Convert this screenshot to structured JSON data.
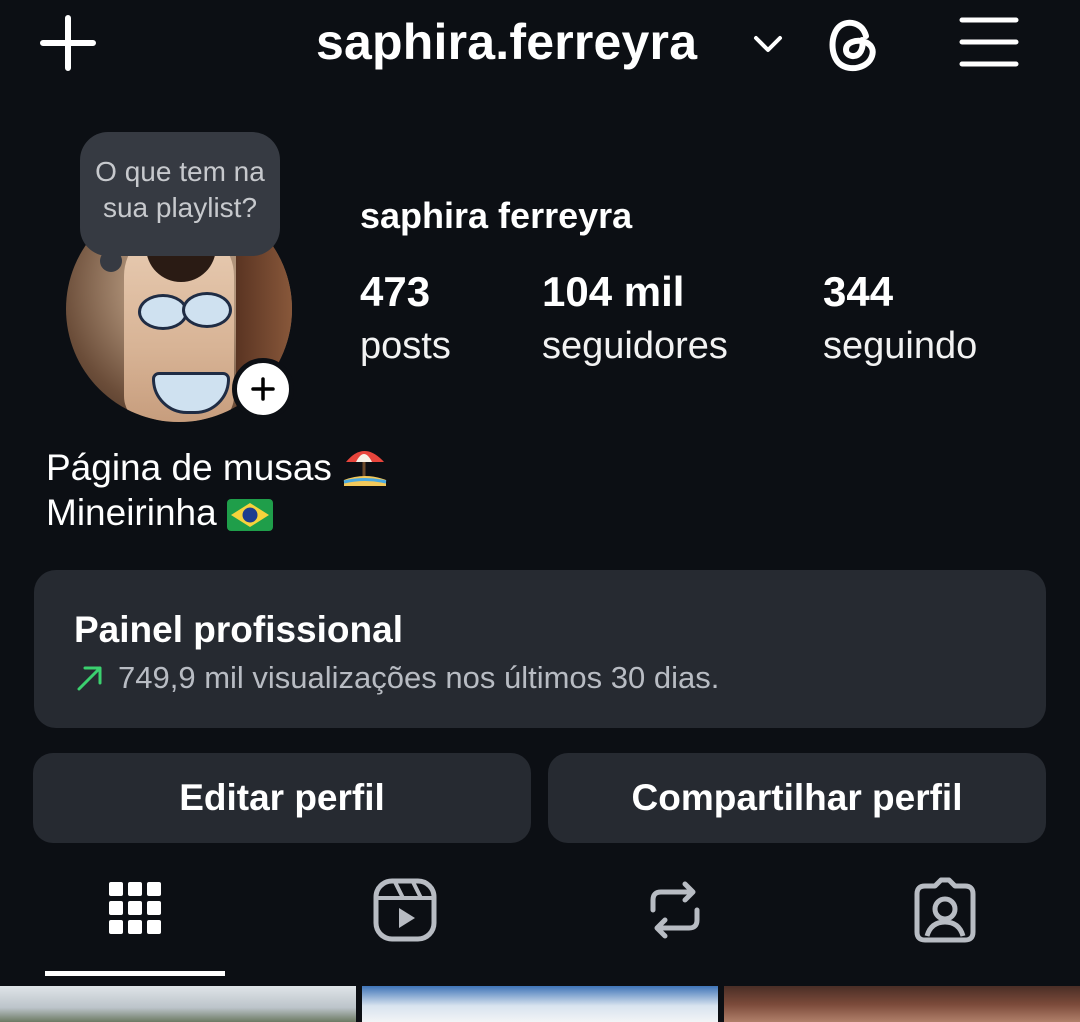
{
  "header": {
    "username": "saphira.ferreyra",
    "icons": [
      "plus-icon",
      "chevron-down-icon",
      "threads-icon",
      "menu-icon"
    ]
  },
  "profile": {
    "note": "O que tem na sua playlist?",
    "display_name": "saphira ferreyra",
    "stats": [
      {
        "value": "473",
        "label": "posts"
      },
      {
        "value": "104 mil",
        "label": "seguidores"
      },
      {
        "value": "344",
        "label": "seguindo"
      }
    ],
    "bio": [
      "Página de musas",
      "Mineirinha"
    ],
    "bio_emojis": [
      "beach-umbrella-emoji",
      "brazil-flag-emoji"
    ]
  },
  "dashboard": {
    "title": "Painel profissional",
    "subtitle": "749,9 mil visualizações nos últimos 30 dias.",
    "accent": "#3bd16f"
  },
  "actions": {
    "edit": "Editar perfil",
    "share": "Compartilhar perfil"
  },
  "tabs": [
    "grid-icon",
    "reels-icon",
    "reposts-icon",
    "tagged-icon"
  ],
  "colors": {
    "background": "#0c0f14",
    "card": "#262a31",
    "note": "#363a42"
  }
}
